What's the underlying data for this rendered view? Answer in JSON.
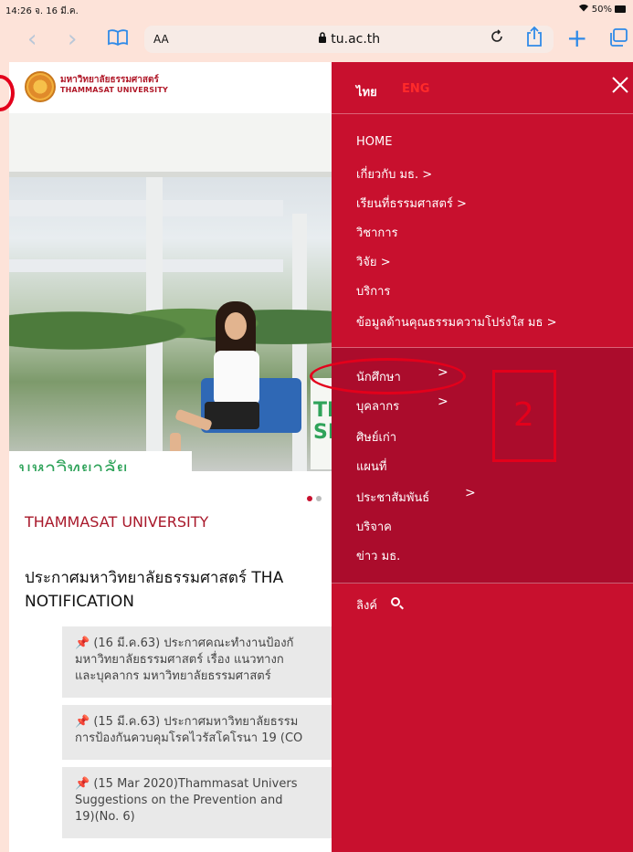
{
  "status_bar": {
    "time": "14:26",
    "date": "จ. 16 มี.ค.",
    "wifi_icon": "wifi-icon",
    "battery": "50%"
  },
  "browser": {
    "back_icon": "‹",
    "forward_icon": "›",
    "bookmarks_icon": "book-icon",
    "text_size_label": "AA",
    "url": "tu.ac.th",
    "reload_icon": "reload-icon",
    "share_icon": "share-icon",
    "new_tab_icon": "plus-icon",
    "tabs_icon": "tabs-icon"
  },
  "site": {
    "logo_thai": "มหาวิทยาลัยธรรมศาสตร์",
    "logo_english": "THAMMASAT UNIVERSITY",
    "hero_sign": "มหาวิทยาลัย",
    "hero_bus_text": "TH\nSH",
    "carousel_pages": 2,
    "carousel_active": 1,
    "title": "THAMMASAT UNIVERSITY",
    "notification_heading_line1": "ประกาศมหาวิทยาลัยธรรมศาสตร์ THA",
    "notification_heading_line2": "NOTIFICATION",
    "notices": [
      {
        "line1": "(16 มี.ค.63) ประกาศคณะทำงานป้องกั",
        "line2": "มหาวิทยาลัยธรรมศาสตร์ เรื่อง แนวทางก",
        "line3": "และบุคลากร มหาวิทยาลัยธรรมศาสตร์"
      },
      {
        "line1": "(15 มี.ค.63) ประกาศมหาวิทยาลัยธรรม",
        "line2": "การป้องกันควบคุมโรคไวรัสโคโรนา 19 (CO"
      },
      {
        "line1": "(15 Mar 2020)Thammasat Univers",
        "line2": "Suggestions on the Prevention and",
        "line3": "19)(No. 6)"
      }
    ]
  },
  "menu": {
    "lang_thai": "ไทย",
    "lang_eng": "ENG",
    "close_icon": "close-icon",
    "items_top": [
      {
        "label": "HOME",
        "has_submenu": false
      },
      {
        "label": "เกี่ยวกับ มธ.",
        "has_submenu": true
      },
      {
        "label": "เรียนที่ธรรมศาสตร์",
        "has_submenu": true
      },
      {
        "label": "วิชาการ",
        "has_submenu": false
      },
      {
        "label": "วิจัย",
        "has_submenu": true
      },
      {
        "label": "บริการ",
        "has_submenu": false
      },
      {
        "label": "ข้อมูลด้านคุณธรรมความโปร่งใส มธ",
        "has_submenu": true
      }
    ],
    "items_bottom": [
      {
        "label": "นักศึกษา",
        "has_submenu": true
      },
      {
        "label": "บุคลากร",
        "has_submenu": true
      },
      {
        "label": "ศิษย์เก่า",
        "has_submenu": false
      },
      {
        "label": "แผนที่",
        "has_submenu": false
      },
      {
        "label": "ประชาสัมพันธ์",
        "has_submenu": true
      },
      {
        "label": "บริจาค",
        "has_submenu": false
      },
      {
        "label": "ข่าว มธ.",
        "has_submenu": false
      }
    ],
    "links_label": "ลิงค์",
    "search_icon": "search-icon",
    "chevron": ">"
  },
  "annotation": {
    "step_number": "2",
    "color": "#e3001b"
  },
  "colors": {
    "menu_red": "#c8102e",
    "menu_dark": "#ab0c2c",
    "brand_red": "#a8182a",
    "safari_blue": "#2f8ae8",
    "eng_highlight": "#ff2a2a"
  }
}
